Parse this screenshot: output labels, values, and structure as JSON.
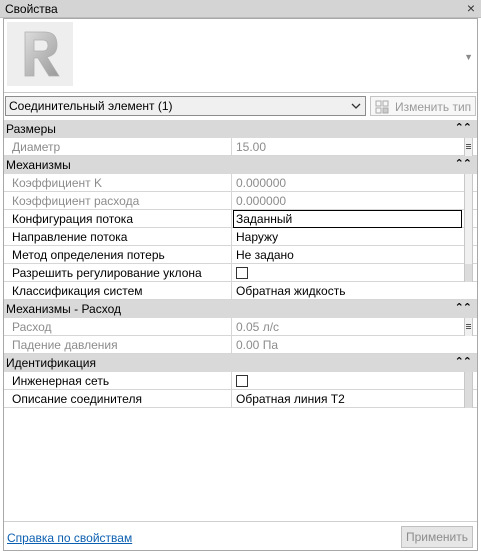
{
  "window": {
    "title": "Свойства"
  },
  "type_selector": {
    "value": "Соединительный элемент (1)",
    "edit_type_label": "Изменить тип"
  },
  "categories": [
    {
      "label": "Размеры",
      "rows": [
        {
          "name": "Диаметр",
          "value": "15.00"
        }
      ]
    },
    {
      "label": "Механизмы",
      "rows": [
        {
          "name": "Коэффициент K",
          "value": "0.000000"
        },
        {
          "name": "Коэффициент расхода",
          "value": "0.000000"
        },
        {
          "name": "Конфигурация потока",
          "value": "Заданный"
        },
        {
          "name": "Направление потока",
          "value": "Наружу"
        },
        {
          "name": "Метод определения потерь",
          "value": "Не задано"
        },
        {
          "name": "Разрешить регулирование уклона",
          "value": ""
        },
        {
          "name": "Классификация систем",
          "value": "Обратная жидкость"
        }
      ]
    },
    {
      "label": "Механизмы - Расход",
      "rows": [
        {
          "name": "Расход",
          "value": "0.05 л/с"
        },
        {
          "name": "Падение давления",
          "value": "0.00 Па"
        }
      ]
    },
    {
      "label": "Идентификация",
      "rows": [
        {
          "name": "Инженерная сеть",
          "value": ""
        },
        {
          "name": "Описание соединителя",
          "value": "Обратная линия Т2"
        }
      ]
    }
  ],
  "footer": {
    "help_link": "Справка по свойствам",
    "apply_label": "Применить"
  }
}
